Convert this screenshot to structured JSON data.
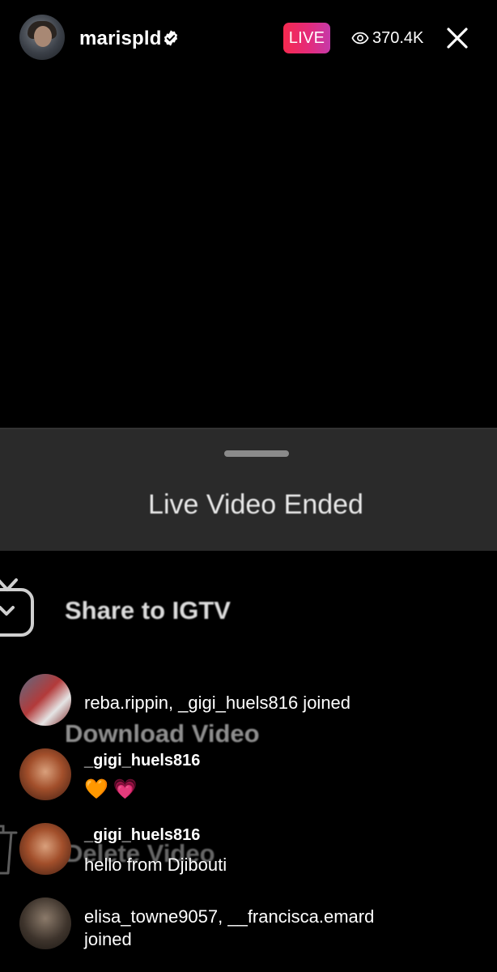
{
  "header": {
    "username": "marispld",
    "live_label": "LIVE",
    "viewer_count": "370.4K"
  },
  "ended_panel": {
    "title": "Live Video Ended"
  },
  "menu": {
    "share_igtv": "Share to IGTV",
    "download": "Download Video",
    "delete": "Delete Video"
  },
  "comments": [
    {
      "text": "reba.rippin, _gigi_huels816 joined"
    },
    {
      "user": "_gigi_huels816",
      "emojis": [
        "🧡",
        "💗"
      ]
    },
    {
      "user": "_gigi_huels816",
      "text": "hello from Djibouti"
    },
    {
      "text": "elisa_towne9057, __francisca.emard joined"
    }
  ],
  "colors": {
    "live_gradient_start": "#f5294f",
    "live_gradient_end": "#c53aa9",
    "background": "#000000",
    "panel": "#2a2a2a"
  }
}
